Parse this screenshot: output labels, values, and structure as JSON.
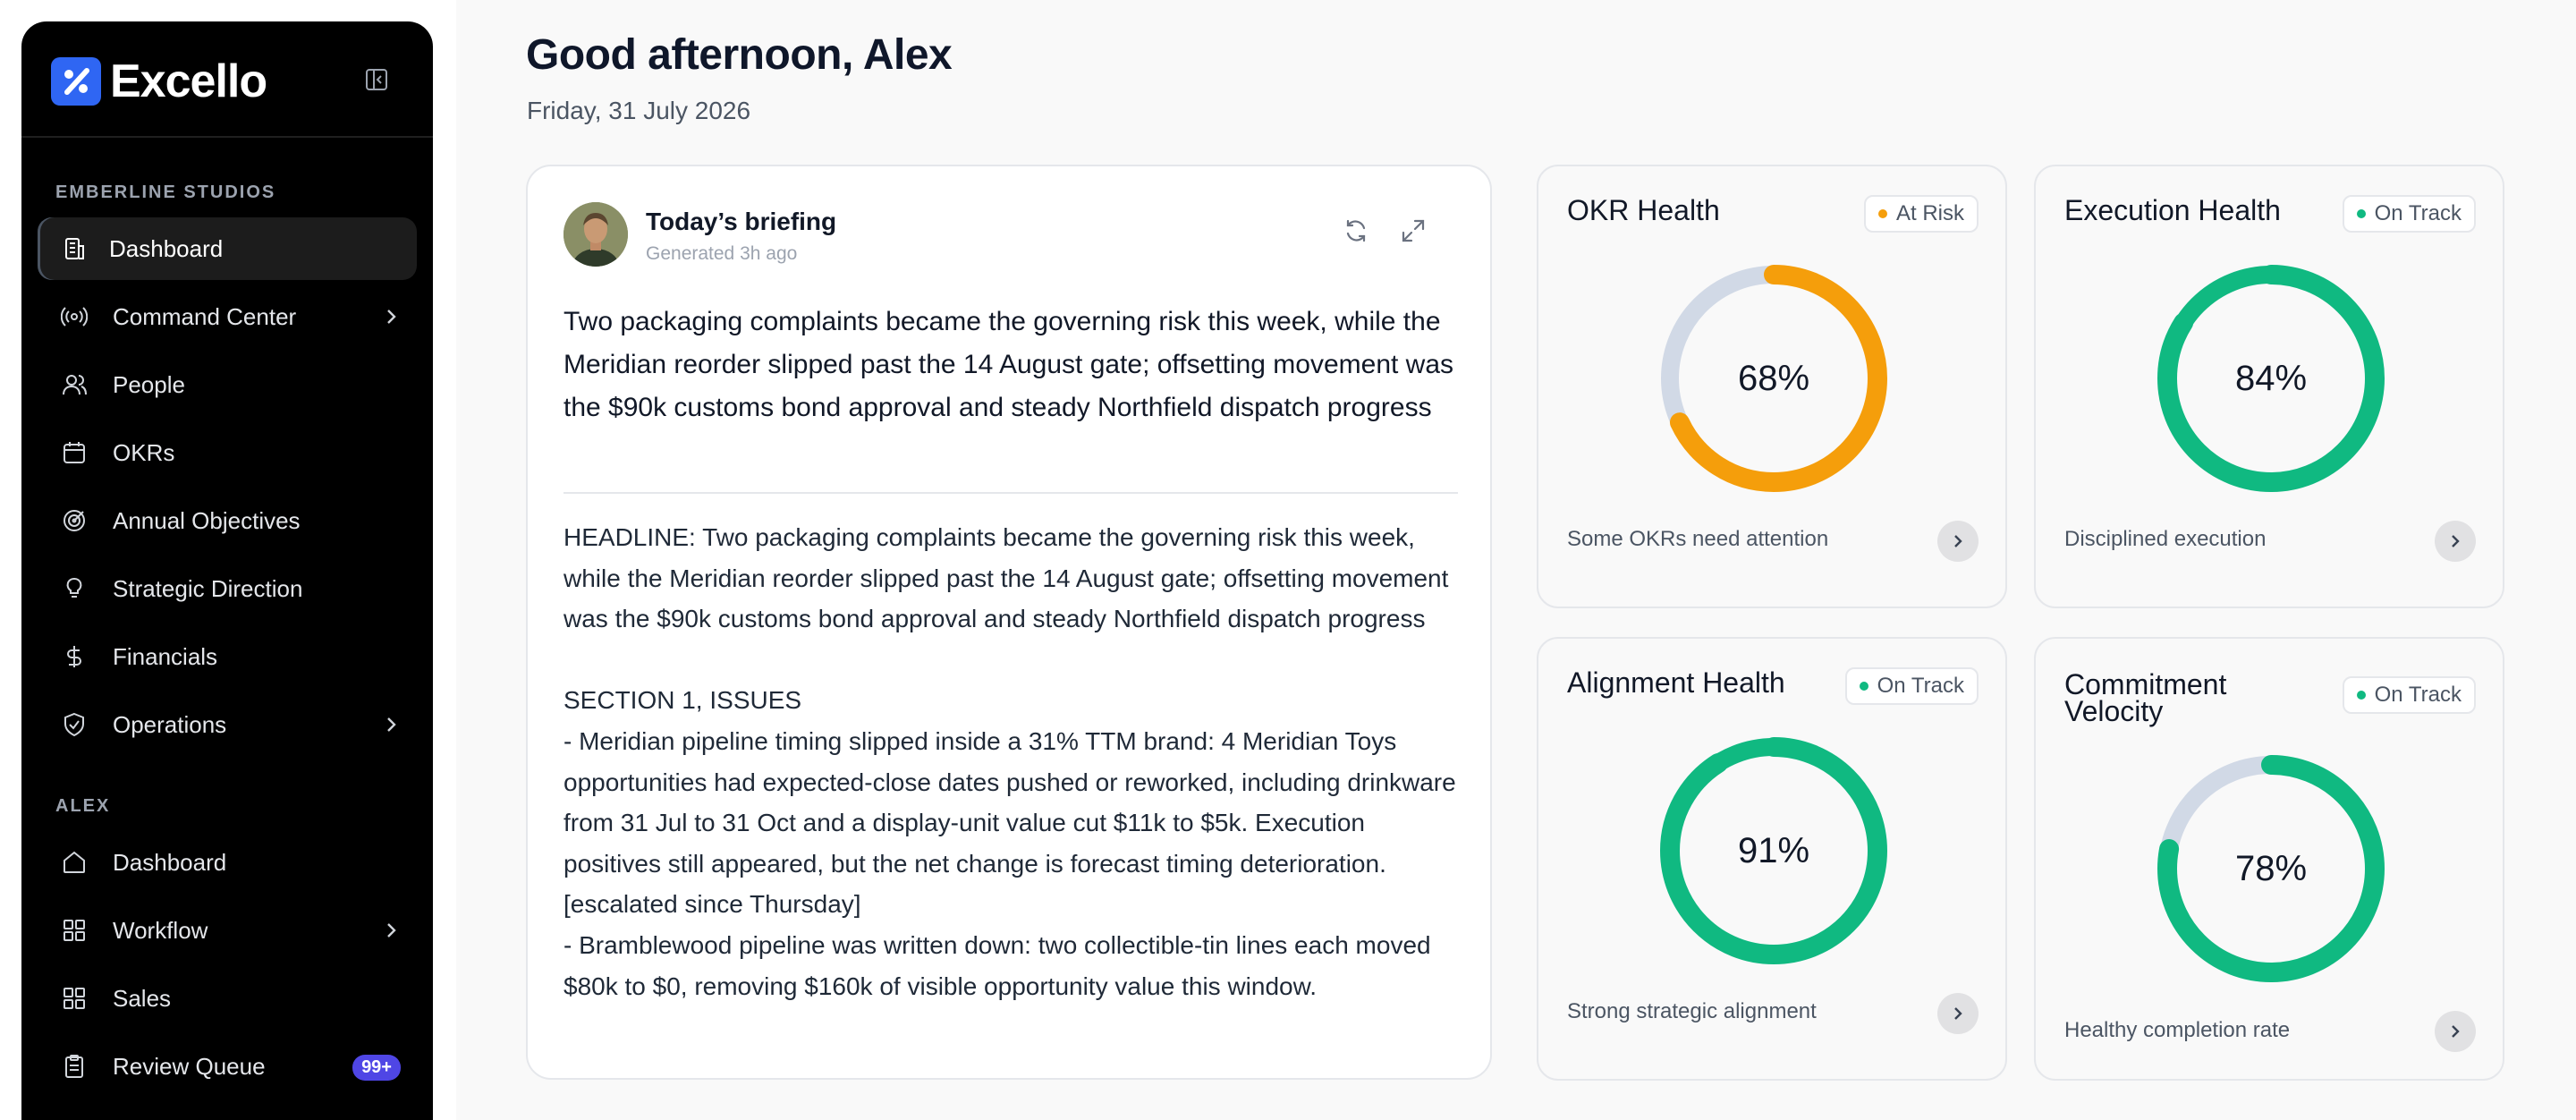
{
  "app": {
    "name": "Excello"
  },
  "sidebar": {
    "workspace_label": "EMBERLINE STUDIOS",
    "workspace_items": [
      {
        "label": "Dashboard",
        "icon": "building-icon",
        "active": true
      },
      {
        "label": "Command Center",
        "icon": "broadcast-icon",
        "has_submenu": true
      },
      {
        "label": "People",
        "icon": "users-icon"
      },
      {
        "label": "OKRs",
        "icon": "calendar-icon"
      },
      {
        "label": "Annual Objectives",
        "icon": "target-icon"
      },
      {
        "label": "Strategic Direction",
        "icon": "lightbulb-icon"
      },
      {
        "label": "Financials",
        "icon": "dollar-icon"
      },
      {
        "label": "Operations",
        "icon": "shield-check-icon",
        "has_submenu": true
      }
    ],
    "user_label": "ALEX",
    "user_items": [
      {
        "label": "Dashboard",
        "icon": "home-icon"
      },
      {
        "label": "Workflow",
        "icon": "grid-icon",
        "has_submenu": true
      },
      {
        "label": "Sales",
        "icon": "grid-icon"
      },
      {
        "label": "Review Queue",
        "icon": "clipboard-icon",
        "badge": "99+"
      }
    ]
  },
  "header": {
    "greeting": "Good afternoon, Alex",
    "date": "Friday, 31 July 2026"
  },
  "briefing": {
    "title": "Today’s briefing",
    "generated": "Generated 3h ago",
    "lead": "Two packaging complaints became the governing risk this week, while the Meridian reorder slipped past the 14 August gate; offsetting movement was the $90k customs bond approval and steady Northfield dispatch progress",
    "body": "HEADLINE: Two packaging complaints became the governing risk this week, while the Meridian reorder slipped past the 14 August gate; offsetting movement was the $90k customs bond approval and steady Northfield dispatch progress\n\nSECTION 1, ISSUES\n- Meridian pipeline timing slipped inside a 31% TTM brand: 4 Meridian Toys opportunities had expected-close dates pushed or reworked, including drinkware from 31 Jul to 31 Oct and a display-unit value cut $11k to $5k. Execution positives still appeared, but the net change is forecast timing deterioration. [escalated since Thursday]\n- Bramblewood pipeline was written down: two collectible-tin lines each moved $80k to $0, removing $160k of visible opportunity value this window."
  },
  "health_cards": [
    {
      "title": "OKR Health",
      "status": "At Risk",
      "status_color": "#f59e0b",
      "percent": 68,
      "value_label": "68%",
      "caption": "Some OKRs need attention",
      "ring_color": "#f59e0b",
      "track_color": "#d1d9e6",
      "tone": "amber"
    },
    {
      "title": "Execution Health",
      "status": "On Track",
      "status_color": "#10b981",
      "percent": 84,
      "value_label": "84%",
      "caption": "Disciplined execution",
      "ring_color": "#10b981",
      "track_color": "#10b981",
      "tone": "green"
    },
    {
      "title": "Alignment Health",
      "status": "On Track",
      "status_color": "#10b981",
      "percent": 91,
      "value_label": "91%",
      "caption": "Strong strategic alignment",
      "ring_color": "#10b981",
      "track_color": "#10b981",
      "tone": "green"
    },
    {
      "title": "Commitment Velocity",
      "status": "On Track",
      "status_color": "#10b981",
      "percent": 78,
      "value_label": "78%",
      "caption": "Healthy completion rate",
      "ring_color": "#10b981",
      "track_color": "#d1d9e6",
      "tone": "green"
    }
  ],
  "colors": {
    "accent": "#2f66f3",
    "badge": "#4f46e5",
    "at_risk": "#f59e0b",
    "on_track": "#10b981"
  }
}
